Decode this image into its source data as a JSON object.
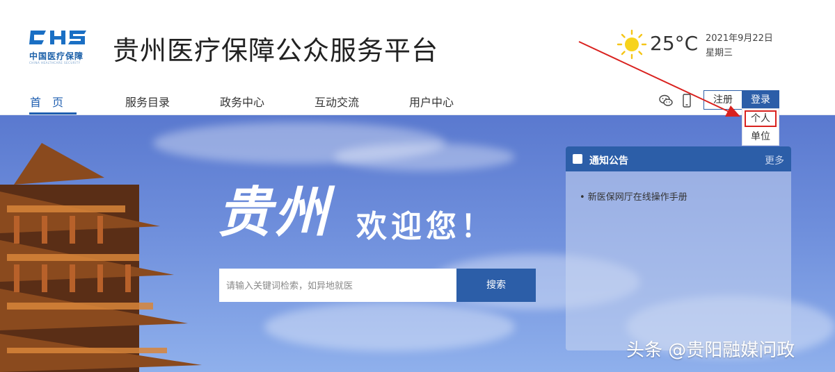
{
  "header": {
    "logo_text": "CHS",
    "logo_cn": "中国医疗保障",
    "logo_en": "CHINA HEALTHCARE SECURITY",
    "title": "贵州医疗保障公众服务平台"
  },
  "weather": {
    "icon": "sun-icon",
    "temperature": "25°C",
    "date": "2021年9月22日",
    "weekday": "星期三"
  },
  "nav": {
    "items": [
      "首　页",
      "服务目录",
      "政务中心",
      "互动交流",
      "用户中心"
    ],
    "active_index": 0,
    "register_label": "注册",
    "login_label": "登录"
  },
  "login_menu": {
    "items": [
      "个人",
      "单位"
    ]
  },
  "banner": {
    "welcome_big": "贵州",
    "welcome_small": "欢迎您！"
  },
  "search": {
    "placeholder": "请输入关键词检索，如异地就医",
    "button_label": "搜索"
  },
  "notice": {
    "title": "通知公告",
    "more_label": "更多",
    "items": [
      "• 新医保网厅在线操作手册"
    ]
  },
  "watermark": "头条 @贵阳融媒问政",
  "colors": {
    "brand": "#2c5ea8",
    "highlight": "#d9211e"
  }
}
